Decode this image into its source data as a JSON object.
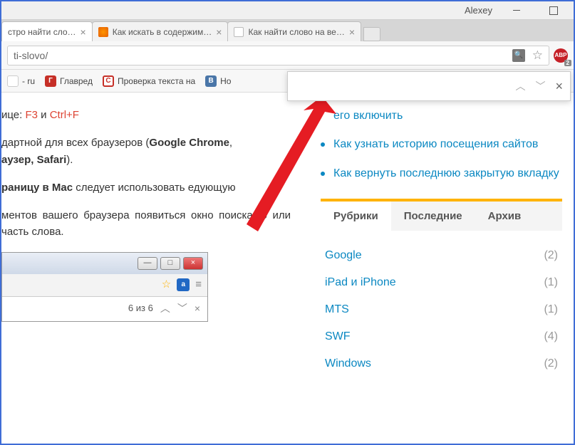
{
  "titlebar": {
    "username": "Alexey"
  },
  "tabs": [
    {
      "label": "стро найти сло…"
    },
    {
      "label": "Как искать в содержим…"
    },
    {
      "label": "Как найти слово на ве…"
    }
  ],
  "omnibox": {
    "url_fragment": "ti-slovo/"
  },
  "bookmarks": {
    "ru": "- ru",
    "glavred": "Главред",
    "proverka": "Проверка текста на",
    "nov": "Но"
  },
  "findbar": {
    "placeholder": ""
  },
  "article": {
    "l1a": "ице: ",
    "l1b": "F3",
    "l1c": " и ",
    "l1d": "Ctrl+F",
    "l2a": "дартной для всех браузеров (",
    "l2b": "Google Chrome",
    "l2c": ", ",
    "l3a": "аузер, Safari",
    "l3b": ").",
    "l4a": "раницу в Mac",
    "l4b": " следует использовать   едующую",
    "l5": "ментов вашего браузера появиться окно поиска, о или часть слова."
  },
  "sidebar_links": {
    "item0": "его включить",
    "item1": "Как узнать историю посещения сайтов",
    "item2": "Как вернуть последнюю закрытую вкладку"
  },
  "widget": {
    "tab1": "Рубрики",
    "tab2": "Последние",
    "tab3": "Архив",
    "cats": [
      {
        "name": "Google",
        "count": "(2)"
      },
      {
        "name": "iPad и iPhone",
        "count": "(1)"
      },
      {
        "name": "MTS",
        "count": "(1)"
      },
      {
        "name": "SWF",
        "count": "(4)"
      },
      {
        "name": "Windows",
        "count": "(2)"
      }
    ]
  },
  "inset": {
    "count": "6 из 6",
    "abp": "ABP",
    "a": "a"
  }
}
